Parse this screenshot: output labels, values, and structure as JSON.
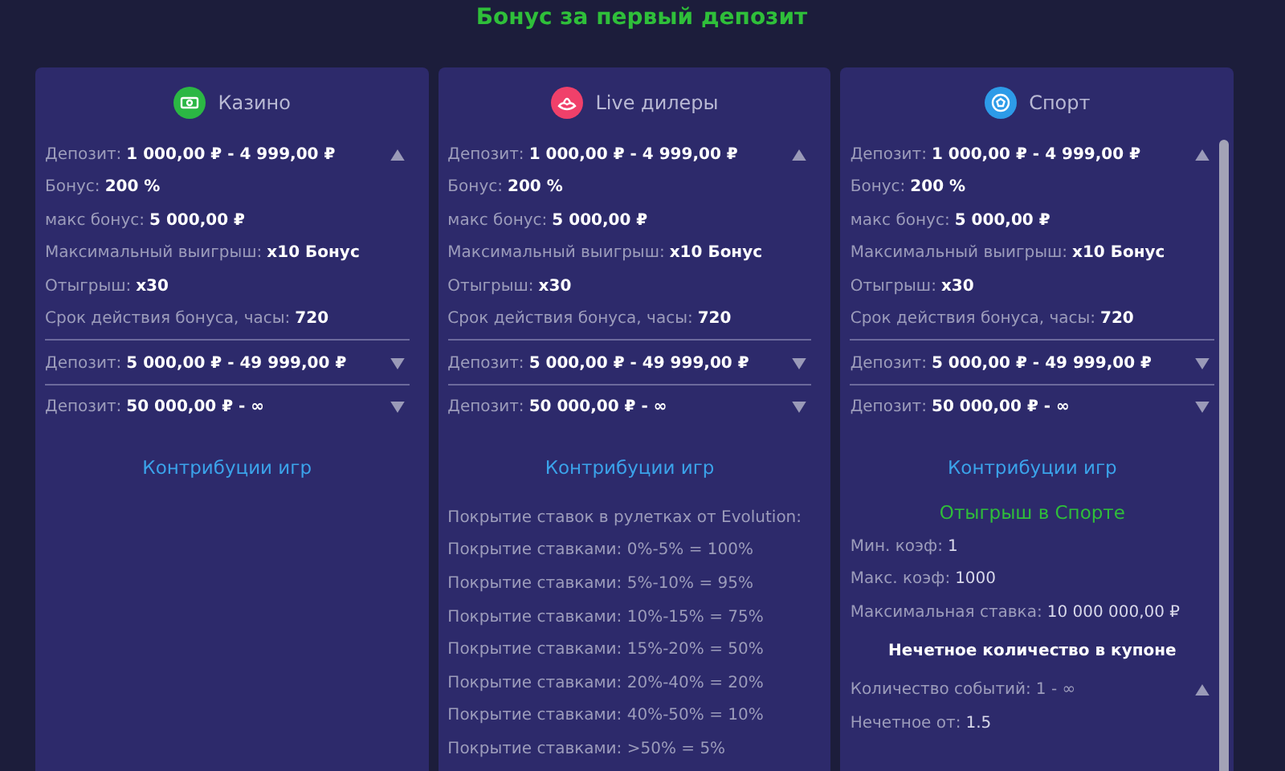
{
  "title": "Бонус за первый депозит",
  "columns": [
    {
      "name": "Казино",
      "kind": "cash",
      "color": "#2bb744",
      "tiers": [
        {
          "label": "Депозит:",
          "value": "1 000,00 ₽ - 4 999,00 ₽",
          "expanded": true,
          "details": [
            {
              "label": "Бонус:",
              "value": "200 %"
            },
            {
              "label": "макс бонус:",
              "value": "5 000,00 ₽"
            },
            {
              "label": "Максимальный выигрыш:",
              "value": "x10 Бонус"
            },
            {
              "label": "Отыгрыш:",
              "value": "x30"
            },
            {
              "label": "Срок действия бонуса, часы:",
              "value": "720"
            }
          ]
        },
        {
          "label": "Депозит:",
          "value": "5 000,00 ₽ - 49 999,00 ₽",
          "expanded": false
        },
        {
          "label": "Депозит:",
          "value": "50 000,00 ₽ - ∞",
          "expanded": false
        }
      ],
      "link": "Контрибуции игр"
    },
    {
      "name": "Live дилеры",
      "kind": "flower",
      "color": "#f0406a",
      "tiers": [
        {
          "label": "Депозит:",
          "value": "1 000,00 ₽ - 4 999,00 ₽",
          "expanded": true,
          "details": [
            {
              "label": "Бонус:",
              "value": "200 %"
            },
            {
              "label": "макс бонус:",
              "value": "5 000,00 ₽"
            },
            {
              "label": "Максимальный выигрыш:",
              "value": "x10 Бонус"
            },
            {
              "label": "Отыгрыш:",
              "value": "x30"
            },
            {
              "label": "Срок действия бонуса, часы:",
              "value": "720"
            }
          ]
        },
        {
          "label": "Депозит:",
          "value": "5 000,00 ₽ - 49 999,00 ₽",
          "expanded": false
        },
        {
          "label": "Депозит:",
          "value": "50 000,00 ₽ - ∞",
          "expanded": false
        }
      ],
      "link": "Контрибуции игр",
      "contributions": [
        "Покрытие ставок в рулетках от Evolution:",
        "Покрытие ставками: 0%-5% = 100%",
        "Покрытие ставками: 5%-10% = 95%",
        "Покрытие ставками: 10%-15% = 75%",
        "Покрытие ставками: 15%-20% = 50%",
        "Покрытие ставками: 20%-40% = 20%",
        "Покрытие ставками: 40%-50% = 10%",
        "Покрытие ставками: >50% = 5%"
      ]
    },
    {
      "name": "Спорт",
      "kind": "ball",
      "color": "#2d9be8",
      "tiers": [
        {
          "label": "Депозит:",
          "value": "1 000,00 ₽ - 4 999,00 ₽",
          "expanded": true,
          "details": [
            {
              "label": "Бонус:",
              "value": "200 %"
            },
            {
              "label": "макс бонус:",
              "value": "5 000,00 ₽"
            },
            {
              "label": "Максимальный выигрыш:",
              "value": "x10 Бонус"
            },
            {
              "label": "Отыгрыш:",
              "value": "x30"
            },
            {
              "label": "Срок действия бонуса, часы:",
              "value": "720"
            }
          ]
        },
        {
          "label": "Депозит:",
          "value": "5 000,00 ₽ - 49 999,00 ₽",
          "expanded": false
        },
        {
          "label": "Депозит:",
          "value": "50 000,00 ₽ - ∞",
          "expanded": false
        }
      ],
      "link": "Контрибуции игр",
      "sport": {
        "title": "Отыгрыш в Спорте",
        "rows": [
          {
            "label": "Мин. коэф:",
            "value": "1"
          },
          {
            "label": "Макс. коэф:",
            "value": "1000"
          },
          {
            "label": "Максимальная ставка:",
            "value": "10 000 000,00 ₽"
          }
        ],
        "subtitle": "Нечетное количество в купоне",
        "tiers": [
          {
            "label": "Количество событий:",
            "value": "1 - ∞",
            "expanded": true,
            "details": [
              {
                "label": "Нечетное от:",
                "value": "1.5"
              }
            ]
          }
        ]
      }
    }
  ]
}
